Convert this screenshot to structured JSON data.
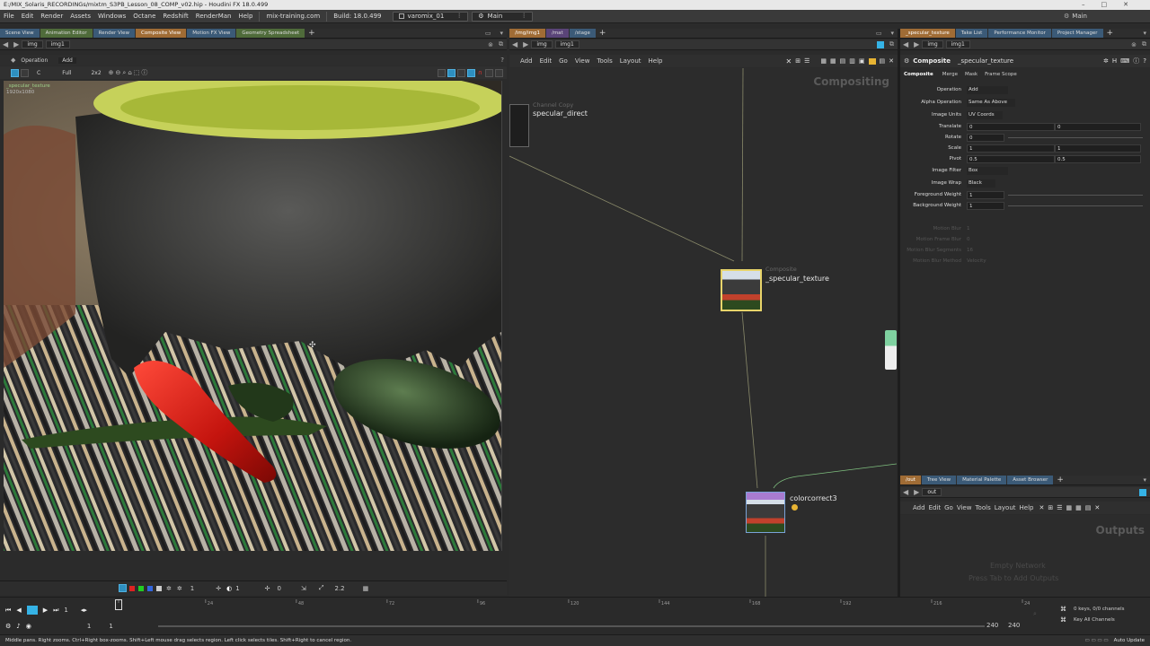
{
  "window": {
    "title": "E:/MIX_Solaris_RECORDINGs/mixtm_S3PB_Lesson_08_COMP_v02.hip - Houdini FX 18.0.499",
    "controls": [
      "–",
      "□",
      "✕"
    ]
  },
  "menubar": {
    "items": [
      "File",
      "Edit",
      "Render",
      "Assets",
      "Windows",
      "Octane",
      "Redshift",
      "RenderMan",
      "Help"
    ],
    "site": "mix-training.com",
    "build": "Build: 18.0.499",
    "desktop": "varomix_01",
    "context": "Main",
    "right_context": "Main"
  },
  "left_pane": {
    "tabs": [
      "Scene View",
      "Animation Editor",
      "Render View",
      "Composite View",
      "Motion FX View",
      "Geometry Spreadsheet"
    ],
    "active_tab": "Composite View",
    "path": [
      "img",
      "img1"
    ],
    "op_label": "Operation",
    "op_value": "Add",
    "toolbar": {
      "c_label": "C",
      "full_label": "Full",
      "zoom_label": "2x2"
    },
    "overlay_name": "_specular_texture",
    "overlay_res": "1920x1080"
  },
  "viewer_bottom": {
    "frame_label": "1",
    "exposure_label": "0",
    "gamma_label": "2.2",
    "zero_label": "0"
  },
  "mid_pane": {
    "tabs": [
      "/img/img1",
      "/mat",
      "/stage"
    ],
    "path": [
      "img",
      "img1"
    ],
    "menu": [
      "Add",
      "Edit",
      "Go",
      "View",
      "Tools",
      "Layout",
      "Help"
    ],
    "context_label": "Compositing",
    "nodes": {
      "channel_copy_type": "Channel Copy",
      "channel_copy_name": "specular_direct",
      "composite_type": "Composite",
      "composite_name": "_specular_texture",
      "cc_name": "colorcorrect3"
    }
  },
  "right_pane": {
    "tabs": [
      "_specular_texture",
      "Take List",
      "Performance Monitor",
      "Project Manager"
    ],
    "path": [
      "img",
      "img1"
    ],
    "header_type": "Composite",
    "header_name": "_specular_texture",
    "subtabs": [
      "Composite",
      "Merge",
      "Mask",
      "Frame Scope"
    ],
    "params": [
      {
        "label": "Operation",
        "value": "Add",
        "kind": "menu"
      },
      {
        "label": "Alpha Operation",
        "value": "Same As Above",
        "kind": "menu"
      },
      {
        "label": "Image Units",
        "value": "UV Coords",
        "kind": "menu"
      },
      {
        "label": "Translate",
        "value": "0",
        "value2": "0",
        "kind": "vec"
      },
      {
        "label": "Rotate",
        "value": "0",
        "kind": "slider"
      },
      {
        "label": "Scale",
        "value": "1",
        "value2": "1",
        "kind": "vec"
      },
      {
        "label": "Pivot",
        "value": "0.5",
        "value2": "0.5",
        "kind": "vec"
      },
      {
        "label": "Image Filter",
        "value": "Box",
        "kind": "menu"
      },
      {
        "label": "Image Wrap",
        "value": "Black",
        "kind": "menu"
      },
      {
        "label": "Foreground Weight",
        "value": "1",
        "kind": "slider"
      },
      {
        "label": "Background Weight",
        "value": "1",
        "kind": "slider"
      }
    ],
    "disabled_params": [
      {
        "label": "Motion Blur",
        "value": "1"
      },
      {
        "label": "Motion Frame Blur",
        "value": "0"
      },
      {
        "label": "Motion Blur Segments",
        "value": "16"
      },
      {
        "label": "Motion Blur Method",
        "value": "Velocity"
      }
    ]
  },
  "bottom_right_pane": {
    "tabs": [
      "/out",
      "Tree View",
      "Material Palette",
      "Asset Browser"
    ],
    "path": [
      "out"
    ],
    "menu": [
      "Add",
      "Edit",
      "Go",
      "View",
      "Tools",
      "Layout",
      "Help"
    ],
    "context_label": "Outputs",
    "empty_line1": "Empty Network",
    "empty_line2": "Press Tab to Add Outputs"
  },
  "timeline": {
    "ticks": [
      "1",
      "24",
      "48",
      "72",
      "96",
      "120",
      "144",
      "168",
      "192",
      "216",
      "240"
    ],
    "current_frame": "1",
    "start": "1",
    "start2": "1",
    "end": "240",
    "end2": "240",
    "keys_info": "0 keys, 0/0 channels",
    "key_all": "Key All Channels",
    "auto_update": "Auto Update"
  },
  "status": {
    "text": "Middle pans. Right zooms. Ctrl+Right box-zooms.   Shift+Left mouse drag selects region. Left click selects tiles. Shift+Right to cancel region."
  },
  "colors": {
    "accent_orange": "#b47a2a",
    "node_selected": "#e8d46a",
    "wire": "#8a8a6a",
    "cyan_button": "#2e8fbf"
  }
}
